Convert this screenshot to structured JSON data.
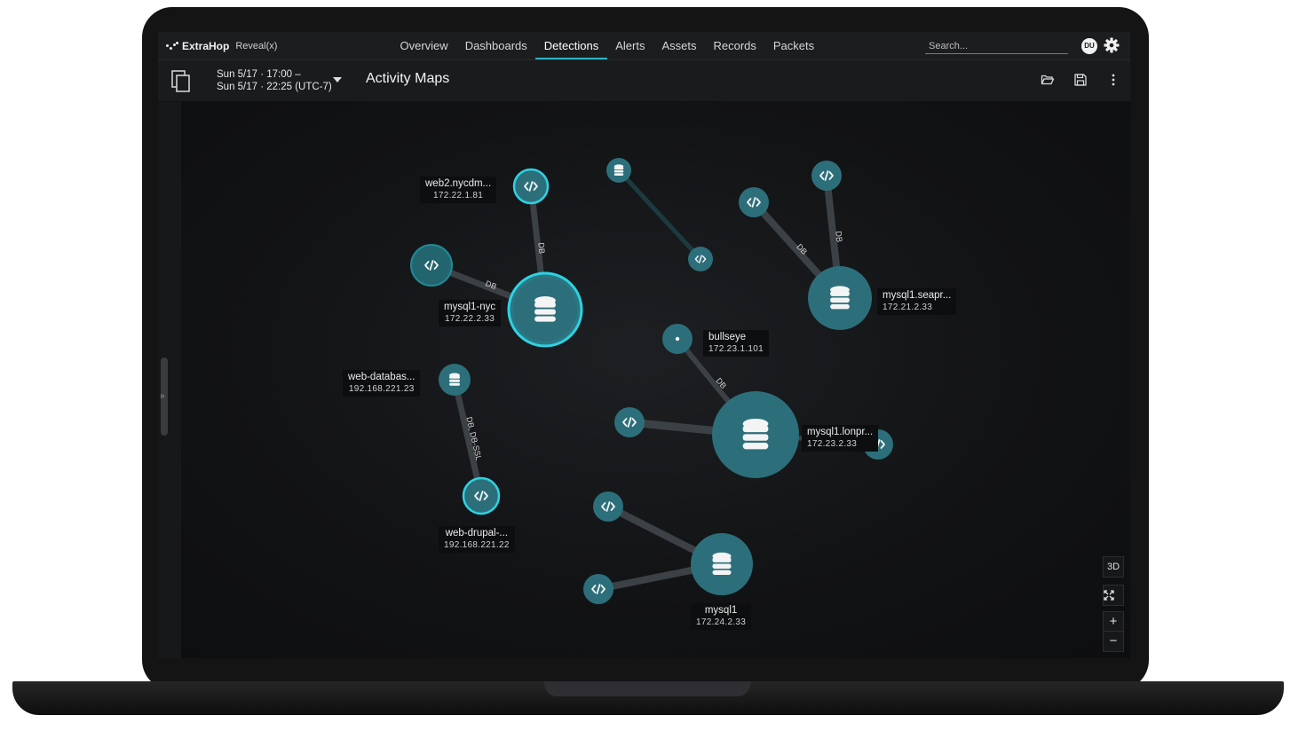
{
  "app": {
    "logo_text": "ExtraHop",
    "logo_sub": "Reveal(x)"
  },
  "nav": {
    "tabs": [
      {
        "label": "Overview",
        "active": false
      },
      {
        "label": "Dashboards",
        "active": false
      },
      {
        "label": "Detections",
        "active": true
      },
      {
        "label": "Alerts",
        "active": false
      },
      {
        "label": "Assets",
        "active": false
      },
      {
        "label": "Records",
        "active": false
      },
      {
        "label": "Packets",
        "active": false
      }
    ]
  },
  "search": {
    "placeholder": "Search..."
  },
  "user": {
    "initials": "DU"
  },
  "toolbar": {
    "time_start": "Sun 5/17 · 17:00 –",
    "time_end": "Sun 5/17 · 22:25 (UTC-7)",
    "title": "Activity Maps"
  },
  "icons": {
    "page": "document-copy-icon",
    "open": "folder-open-icon",
    "save": "save-icon",
    "more": "kebab-menu-icon",
    "settings": "gear-icon",
    "collapse": "double-chevron-right-icon",
    "node_server": "database-icon",
    "node_client": "code-icon",
    "node_device": "dot-icon"
  },
  "colors": {
    "accent": "#2fb3c4",
    "node_fill": "#2b6e7a",
    "node_ring": "#2fd0e0",
    "edge": "#3d4347",
    "edge_faint": "#1f3a3e"
  },
  "map": {
    "nodes": [
      {
        "id": "mysql1-nyc",
        "name": "mysql1-nyc",
        "ip": "172.22.2.33",
        "type": "server",
        "highlight": true
      },
      {
        "id": "web2",
        "name": "web2.nycdm...",
        "ip": "172.22.1.81",
        "type": "client",
        "highlight": true
      },
      {
        "id": "c-nyc-left",
        "type": "client",
        "highlight": true
      },
      {
        "id": "s-small-top",
        "type": "server-small"
      },
      {
        "id": "c-mid-top",
        "type": "client"
      },
      {
        "id": "mysql1-seapr",
        "name": "mysql1.seapr...",
        "ip": "172.21.2.33",
        "type": "server"
      },
      {
        "id": "c-sea-left",
        "type": "client"
      },
      {
        "id": "c-sea-top",
        "type": "client"
      },
      {
        "id": "bullseye",
        "name": "bullseye",
        "ip": "172.23.1.101",
        "type": "device"
      },
      {
        "id": "mysql1-lonpr",
        "name": "mysql1.lonpr...",
        "ip": "172.23.2.33",
        "type": "server"
      },
      {
        "id": "c-lon-left",
        "type": "client"
      },
      {
        "id": "c-lon-right",
        "type": "client"
      },
      {
        "id": "web-databas",
        "name": "web-databas...",
        "ip": "192.168.221.23",
        "type": "server-small"
      },
      {
        "id": "web-drupal",
        "name": "web-drupal-...",
        "ip": "192.168.221.22",
        "type": "client",
        "highlight": true
      },
      {
        "id": "mysql1",
        "name": "mysql1",
        "ip": "172.24.2.33",
        "type": "server"
      },
      {
        "id": "c-m1-top",
        "type": "client"
      },
      {
        "id": "c-m1-left",
        "type": "client"
      }
    ],
    "edges": [
      {
        "from": "web2",
        "to": "mysql1-nyc",
        "label": "DB"
      },
      {
        "from": "c-nyc-left",
        "to": "mysql1-nyc",
        "label": "DB"
      },
      {
        "from": "s-small-top",
        "to": "c-mid-top",
        "label": ""
      },
      {
        "from": "c-sea-left",
        "to": "mysql1-seapr",
        "label": "DB"
      },
      {
        "from": "c-sea-top",
        "to": "mysql1-seapr",
        "label": "DB"
      },
      {
        "from": "bullseye",
        "to": "mysql1-lonpr",
        "label": "DB"
      },
      {
        "from": "c-lon-left",
        "to": "mysql1-lonpr",
        "label": ""
      },
      {
        "from": "c-lon-right",
        "to": "mysql1-lonpr",
        "label": ""
      },
      {
        "from": "web-databas",
        "to": "web-drupal",
        "label": "DB, DB-SSL"
      },
      {
        "from": "c-m1-top",
        "to": "mysql1",
        "label": ""
      },
      {
        "from": "c-m1-left",
        "to": "mysql1",
        "label": ""
      }
    ]
  },
  "controls": {
    "view_3d": "3D",
    "zoom_in": "+",
    "zoom_out": "−",
    "fit": "fit-screen-icon"
  }
}
